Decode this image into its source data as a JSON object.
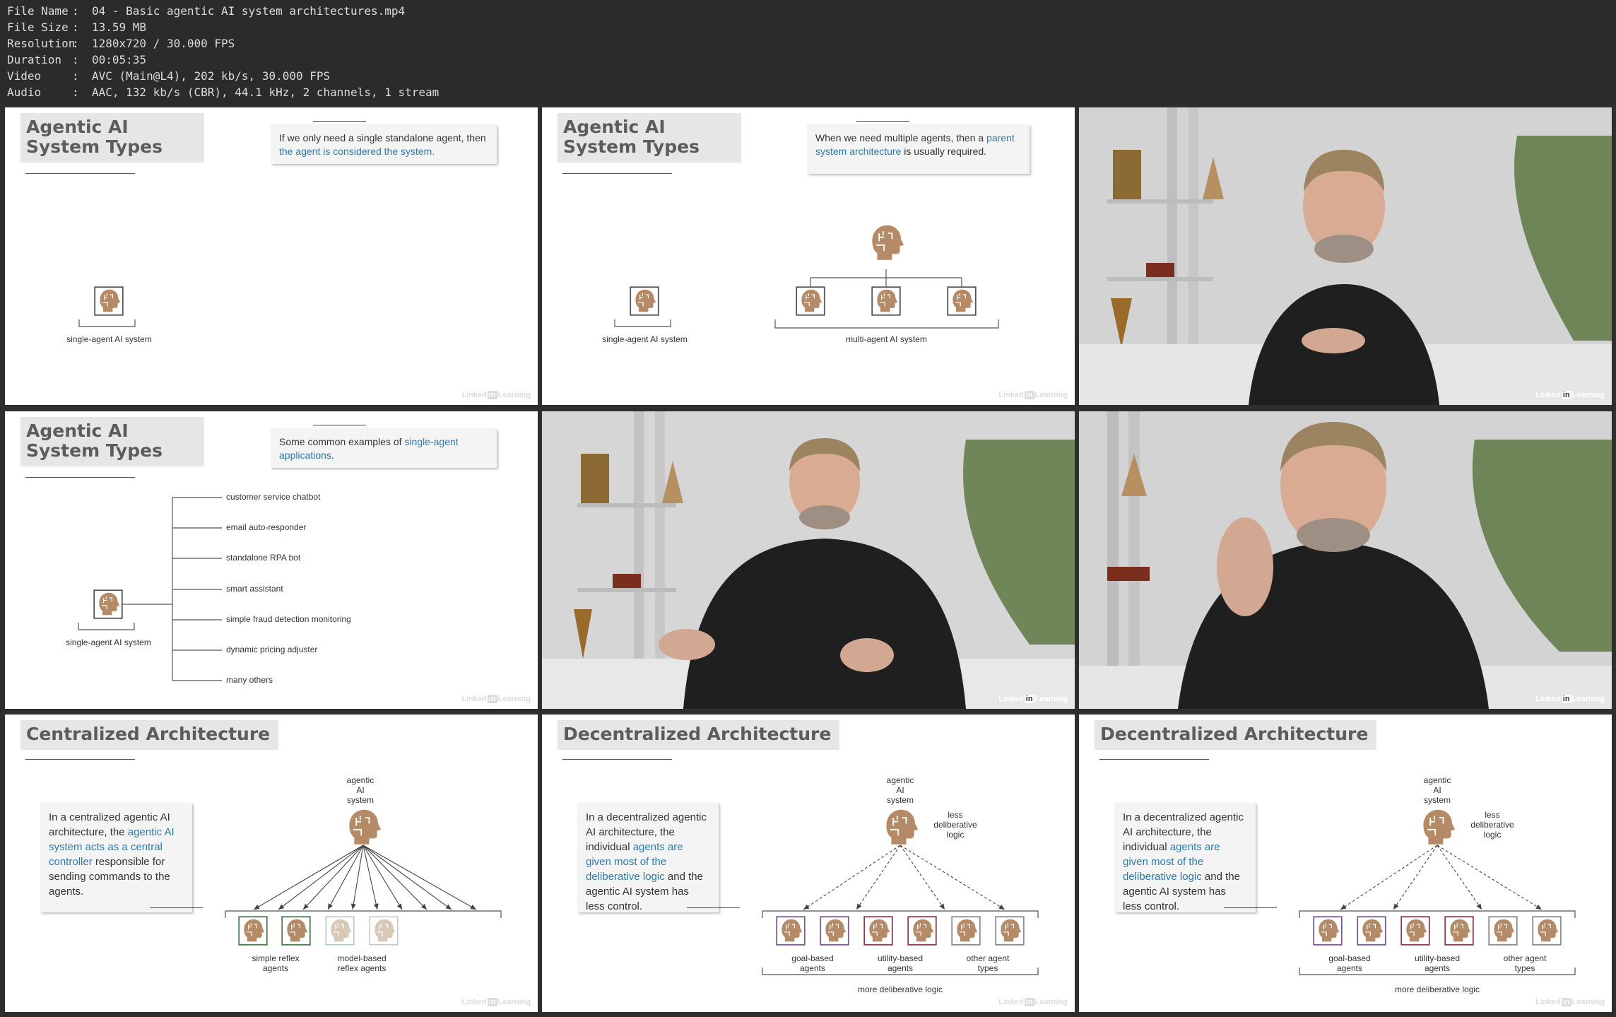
{
  "meta": [
    {
      "key": "File Name",
      "value": "04 - Basic agentic AI system architectures.mp4"
    },
    {
      "key": "File Size",
      "value": "13.59 MB"
    },
    {
      "key": "Resolution",
      "value": "1280x720 / 30.000 FPS"
    },
    {
      "key": "Duration",
      "value": "00:05:35"
    },
    {
      "key": "Video",
      "value": "AVC (Main@L4), 202 kb/s, 30.000 FPS"
    },
    {
      "key": "Audio",
      "value": "AAC, 132 kb/s (CBR), 44.1 kHz, 2 channels, 1 stream"
    }
  ],
  "meta_sep": ":",
  "watermark": {
    "part1": "Linked",
    "in": "in",
    "part2": "Learning"
  },
  "slides": {
    "s1": {
      "title": "Agentic AI System Types",
      "callout_a": "If we only need a single standalone agent, then ",
      "callout_hl": "the agent is considered the system.",
      "label": "single-agent AI system"
    },
    "s2": {
      "title": "Agentic AI System Types",
      "callout_a": "When we need multiple agents, then a ",
      "callout_hl": "parent system architecture",
      "callout_b": " is usually required.",
      "label_single": "single-agent AI system",
      "label_multi": "multi-agent AI system"
    },
    "s4": {
      "title": "Agentic AI System Types",
      "callout_a": "Some common examples of ",
      "callout_hl": "single-agent applications",
      "callout_b": ".",
      "label": "single-agent AI system",
      "items": [
        "customer service chatbot",
        "email auto-responder",
        "standalone RPA bot",
        "smart assistant",
        "simple fraud detection monitoring",
        "dynamic pricing adjuster",
        "many others"
      ]
    },
    "s7": {
      "title": "Centralized Architecture",
      "body_a": "In a centralized agentic AI architecture, the ",
      "body_hl": "agentic AI system acts as a central controller",
      "body_b": " responsible for sending commands to the agents.",
      "top_label": "agentic AI system",
      "group1": "simple reflex agents",
      "group2": "model-based reflex agents"
    },
    "s8": {
      "title": "Decentralized Architecture",
      "body_a": "In a decentralized agentic AI architecture, the individual ",
      "body_hl": "agents are given most of the deliberative logic",
      "body_b": " and the agentic AI system has less control.",
      "top_label": "agentic AI system",
      "less": "less deliberative logic",
      "group1": "goal-based agents",
      "group2": "utility-based agents",
      "group3": "other agent types",
      "more": "more deliberative logic"
    },
    "s9": {
      "title": "Decentralized Architecture",
      "body_a": "In a decentralized agentic AI architecture, the individual ",
      "body_hl": "agents are given most of the deliberative logic",
      "body_b": " and the agentic AI system has less control.",
      "top_label": "agentic AI system",
      "less": "less deliberative logic",
      "group1": "goal-based agents",
      "group2": "utility-based agents",
      "group3": "other agent types",
      "more": "more deliberative logic"
    }
  },
  "colors": {
    "highlight": "#2e78ad",
    "head": "#b58a66",
    "green_frame": "#4c7a4f",
    "purple_frame": "#7b5a8e",
    "maroon_frame": "#8a3d4f",
    "grey_frame": "#8c8c8c",
    "less_text": "#a23a55",
    "more_text": "#2f9d48"
  }
}
